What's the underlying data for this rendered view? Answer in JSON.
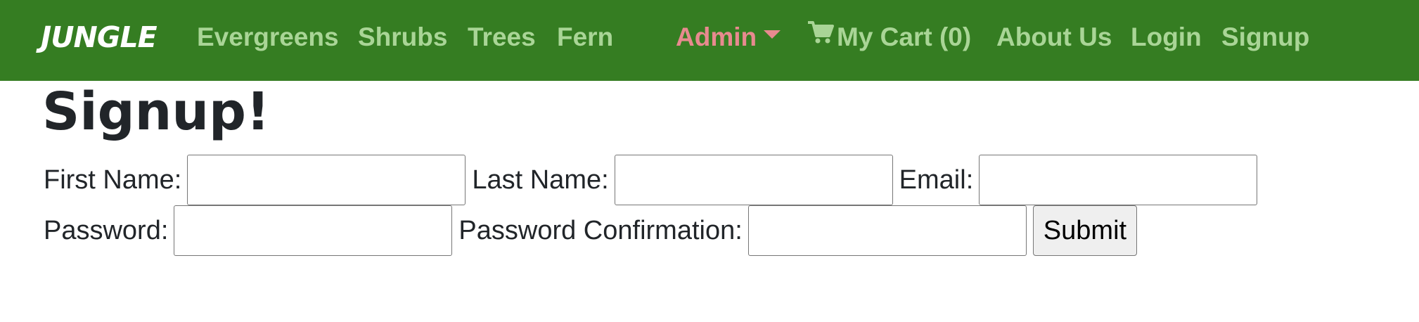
{
  "navbar": {
    "brand": "JUNGLE",
    "links": [
      "Evergreens",
      "Shrubs",
      "Trees",
      "Fern"
    ],
    "admin_label": "Admin",
    "cart_label": "My Cart (0)",
    "about_label": "About Us",
    "login_label": "Login",
    "signup_label": "Signup",
    "colors": {
      "background": "#357d22",
      "link": "#a9d596",
      "admin": "#e88a8f"
    }
  },
  "page": {
    "title": "Signup!"
  },
  "form": {
    "first_name_label": "First Name:",
    "last_name_label": "Last Name:",
    "email_label": "Email:",
    "password_label": "Password:",
    "password_confirmation_label": "Password Confirmation:",
    "first_name_value": "",
    "last_name_value": "",
    "email_value": "",
    "password_value": "",
    "password_confirmation_value": "",
    "submit_label": "Submit"
  },
  "icons": {
    "cart": "shopping-cart-icon",
    "admin_dropdown": "caret-down-icon"
  }
}
